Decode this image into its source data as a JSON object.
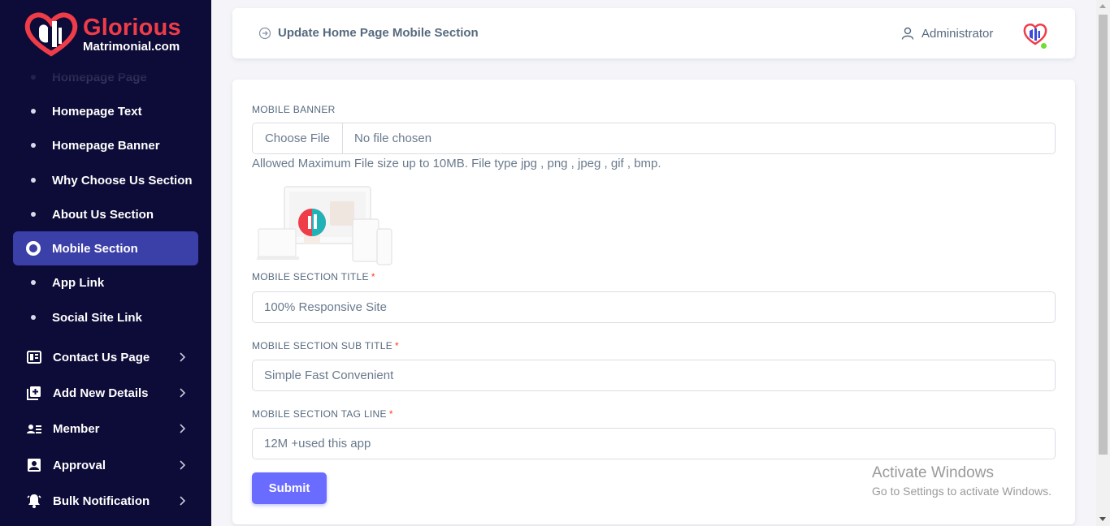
{
  "brand": {
    "name_line1": "Glorious",
    "name_line2": "Matrimonial.com"
  },
  "sidebar": {
    "sub_items": [
      {
        "label": "Homepage Page",
        "state": "faded"
      },
      {
        "label": "Homepage Text"
      },
      {
        "label": "Homepage Banner"
      },
      {
        "label": "Why Choose Us Section"
      },
      {
        "label": "About Us Section"
      },
      {
        "label": "Mobile Section",
        "state": "active"
      },
      {
        "label": "App Link"
      },
      {
        "label": "Social Site Link"
      }
    ],
    "main_items": [
      {
        "label": "Contact Us Page",
        "icon": "contact-page-icon"
      },
      {
        "label": "Add New Details",
        "icon": "add-details-icon"
      },
      {
        "label": "Member",
        "icon": "member-icon"
      },
      {
        "label": "Approval",
        "icon": "approval-icon"
      },
      {
        "label": "Bulk Notification",
        "icon": "bell-icon"
      }
    ]
  },
  "header": {
    "title": "Update Home Page Mobile Section",
    "user": "Administrator"
  },
  "form": {
    "banner_label": "MOBILE BANNER",
    "file_button": "Choose File",
    "file_status": "No file chosen",
    "file_help": "Allowed Maximum File size up to 10MB. File type jpg , png , jpeg , gif , bmp.",
    "title_label": "MOBILE SECTION TITLE",
    "title_value": "100% Responsive Site",
    "subtitle_label": "MOBILE SECTION SUB TITLE",
    "subtitle_value": "Simple Fast Convenient",
    "tagline_label": "MOBILE SECTION TAG LINE",
    "tagline_value": "12M +used this app",
    "required_mark": "*",
    "submit_label": "Submit"
  },
  "watermark": {
    "line1": "Activate Windows",
    "line2": "Go to Settings to activate Windows."
  },
  "colors": {
    "sidebar_bg": "#0d0b38",
    "active_item": "#3b3fa8",
    "brand_red": "#ee3d48",
    "primary": "#696cff"
  }
}
